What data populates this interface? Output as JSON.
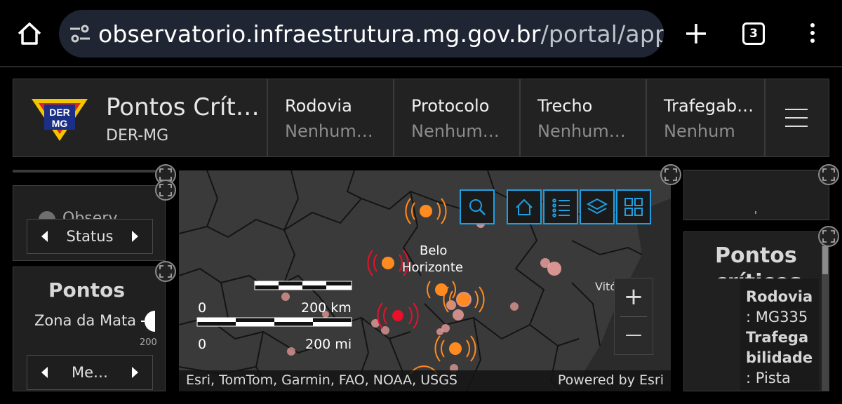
{
  "browser": {
    "url_domain": "observatorio.infraestrutura.mg.gov.br",
    "url_path": "/portal/apps/d",
    "tab_count": "3"
  },
  "header": {
    "logo_text_top": "DER",
    "logo_text_bottom": "MG",
    "title": "Pontos Crít…",
    "subtitle": "DER-MG",
    "selectors": [
      {
        "label": "Rodovia",
        "value": "Nenhum…"
      },
      {
        "label": "Protocolo",
        "value": "Nenhum…"
      },
      {
        "label": "Trecho",
        "value": "Nenhum…"
      },
      {
        "label": "Trafegab…",
        "value": "Nenhum"
      }
    ]
  },
  "left_panels": {
    "status_panel": {
      "partial_text": "Observ…",
      "nav_label": "Status"
    },
    "region_panel": {
      "title": "Pontos",
      "item_label": "Zona da Mata",
      "gauge_value": "200",
      "nav_label": "Me…"
    }
  },
  "map": {
    "city_label_1": "Belo",
    "city_label_2": "Horizonte",
    "city_label_partial": "Vitó",
    "scale_km_zero": "0",
    "scale_km": "200 km",
    "scale_mi_zero": "0",
    "scale_mi": "200 mi",
    "attribution": "Esri, TomTom, Garmin, FAO, NOAA, USGS",
    "powered_by": "Powered by Esri",
    "tools": [
      "search-icon",
      "home-icon",
      "legend-icon",
      "layers-icon",
      "basemap-gallery-icon"
    ],
    "zoom_in": "+",
    "zoom_out": "—"
  },
  "right_panels": {
    "details_title": "Pontos",
    "details_title_partial": "críticos",
    "rows": [
      {
        "key": "Rodovia",
        "value": ": MG335"
      },
      {
        "key": "Trafega",
        "key2": "bilidade",
        "value": ": Pista"
      }
    ]
  },
  "colors": {
    "accent_blue": "#1e9fe4",
    "marker_orange": "#ff8a1f",
    "marker_red": "#e8102a",
    "marker_pink": "#f3a4a0"
  }
}
